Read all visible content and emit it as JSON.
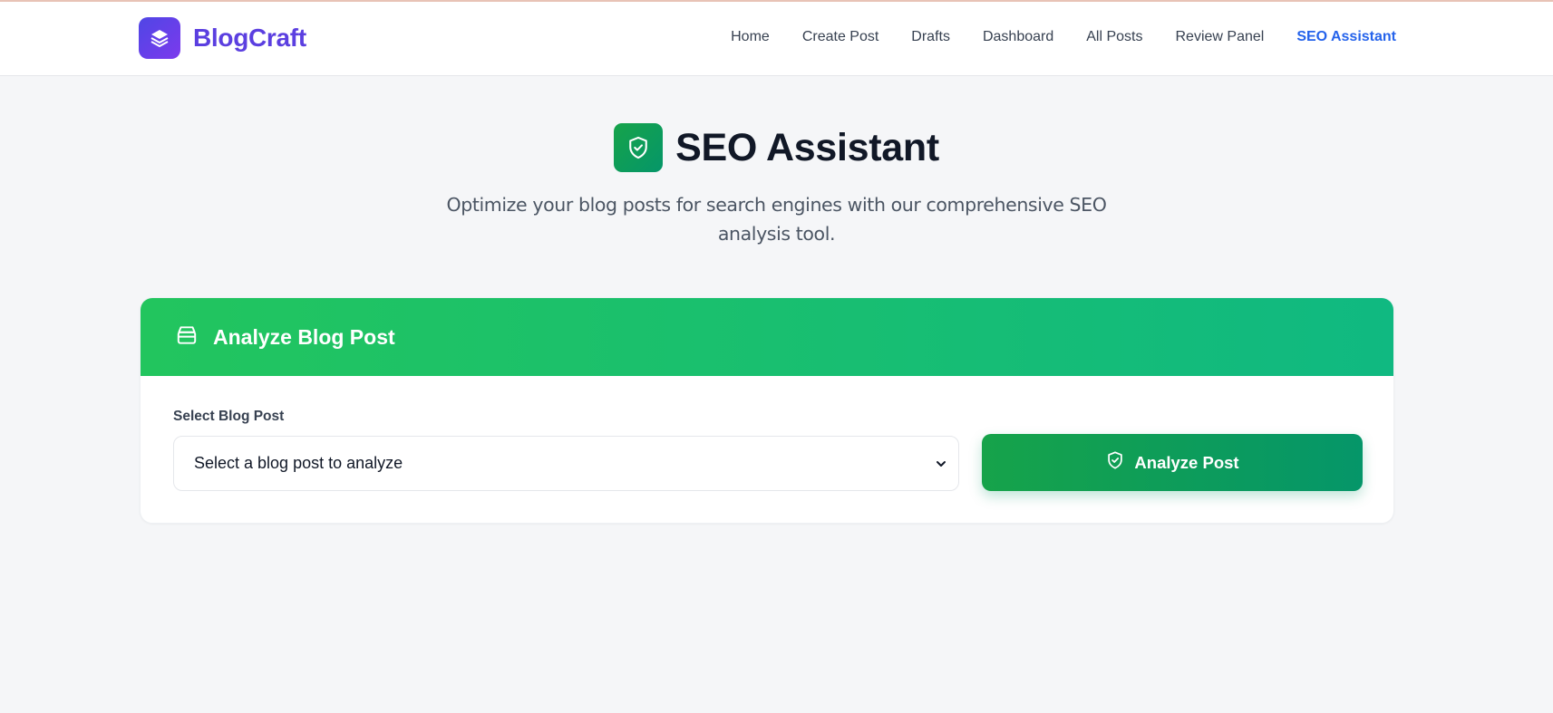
{
  "brand": {
    "name": "BlogCraft",
    "logo_icon": "layers-icon"
  },
  "nav": {
    "items": [
      {
        "label": "Home"
      },
      {
        "label": "Create Post"
      },
      {
        "label": "Drafts"
      },
      {
        "label": "Dashboard"
      },
      {
        "label": "All Posts"
      },
      {
        "label": "Review Panel"
      },
      {
        "label": "SEO Assistant",
        "active": true
      }
    ]
  },
  "hero": {
    "icon": "shield-check-icon",
    "title": "SEO Assistant",
    "subtitle": "Optimize your blog posts for search engines with our comprehensive SEO analysis tool."
  },
  "card": {
    "header_icon": "archive-box-icon",
    "title": "Analyze Blog Post",
    "select_label": "Select Blog Post",
    "select_value": "Select a blog post to analyze",
    "button_label": "Analyze Post",
    "button_icon": "shield-check-icon"
  },
  "colors": {
    "brand": "#5b3fe0",
    "active_nav": "#2563eb",
    "accent_green": "#16a34a",
    "header_green": "#22c55e"
  }
}
